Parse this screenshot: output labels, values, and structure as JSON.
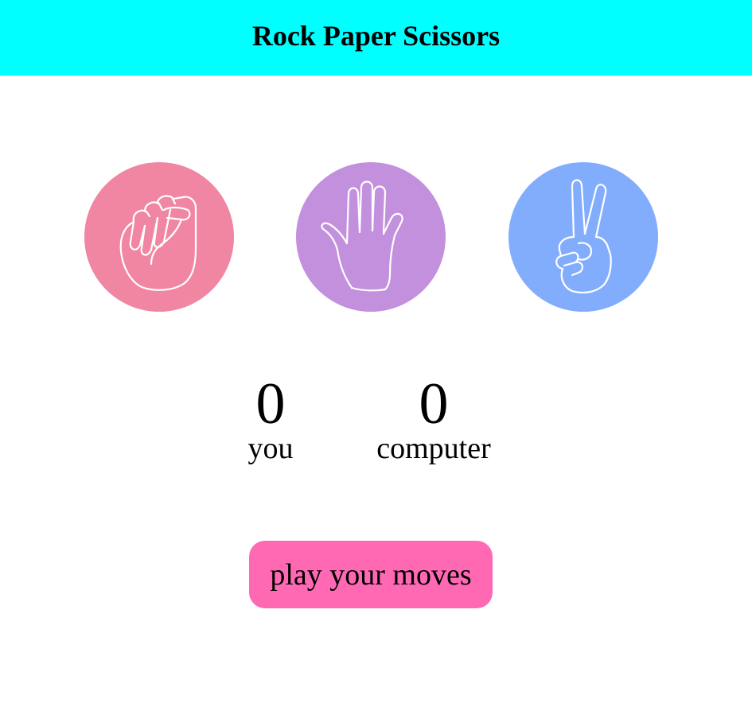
{
  "header": {
    "title": "Rock Paper Scissors",
    "background": "#00ffff"
  },
  "choices": [
    {
      "id": "rock",
      "icon": "fist-icon",
      "color": "#f086a2"
    },
    {
      "id": "paper",
      "icon": "open-hand-icon",
      "color": "#c390dd"
    },
    {
      "id": "scissors",
      "icon": "peace-hand-icon",
      "color": "#82adfd"
    }
  ],
  "scores": {
    "you": {
      "value": "0",
      "label": "you"
    },
    "computer": {
      "value": "0",
      "label": "computer"
    }
  },
  "play_button": {
    "label": "play your moves",
    "color": "#ff69b4"
  }
}
